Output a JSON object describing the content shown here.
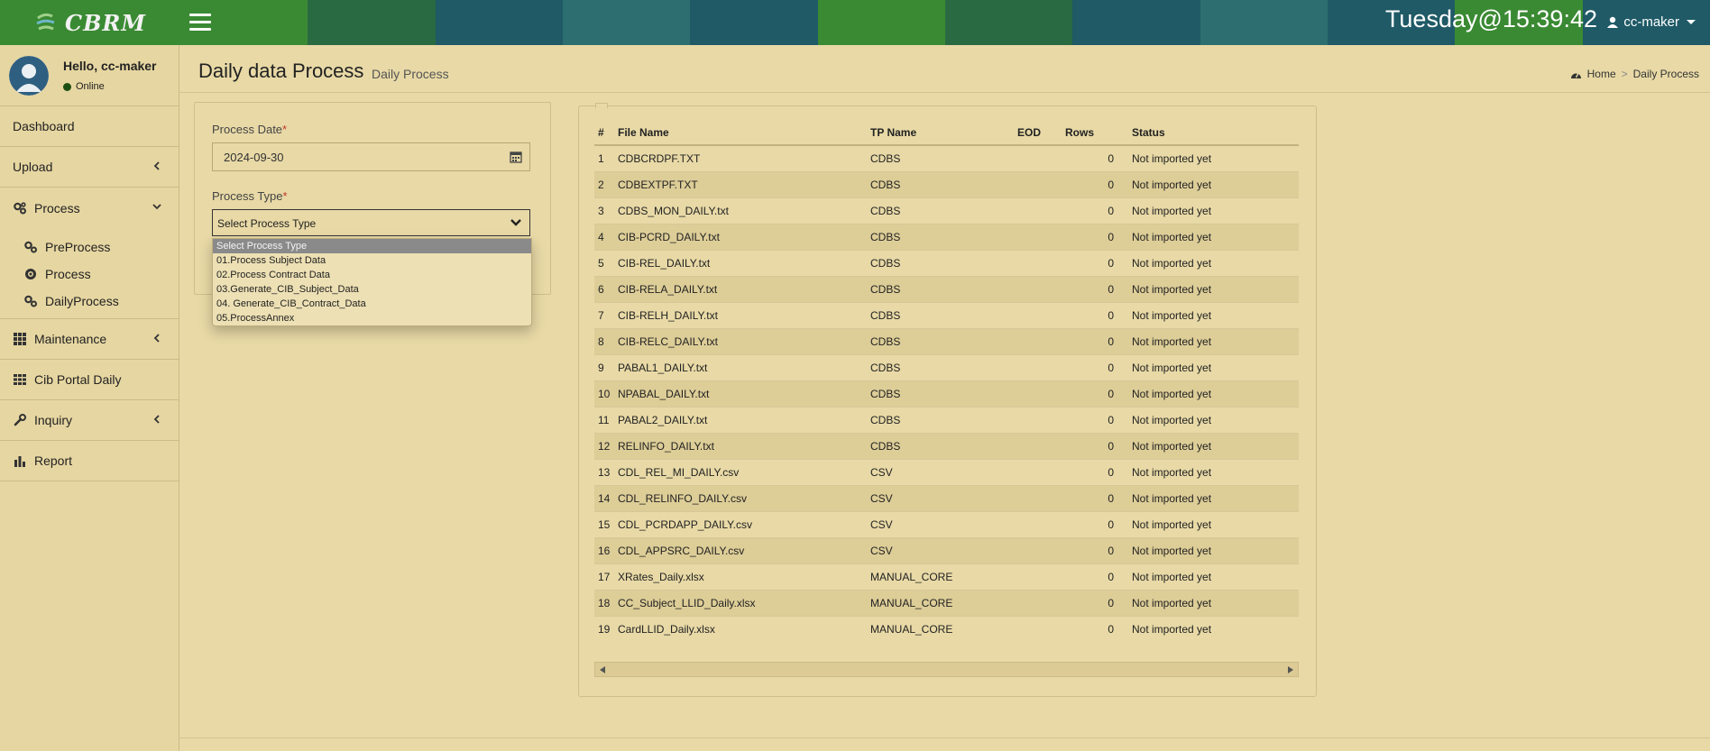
{
  "header": {
    "logo_text": "CBRM",
    "clock": "Tuesday@15:39:42",
    "user": "cc-maker",
    "bands": [
      "#3a8a33",
      "#2a6a42",
      "#1f5a66",
      "#2d6f70",
      "#1f5a66",
      "#3a8a33",
      "#2a6a42",
      "#1f5a66",
      "#2d6f70",
      "#1f5a66",
      "#3a8a33",
      "#1f5a66"
    ]
  },
  "sidebar": {
    "greeting": "Hello, cc-maker",
    "status": "Online",
    "items": [
      {
        "label": "Dashboard",
        "icon": ""
      },
      {
        "label": "Upload",
        "icon": ""
      },
      {
        "label": "Process",
        "icon": "gears-icon"
      },
      {
        "label": "Maintenance",
        "icon": "grid-icon"
      },
      {
        "label": "Cib Portal Daily",
        "icon": "grid-small-icon"
      },
      {
        "label": "Inquiry",
        "icon": "wrench-icon"
      },
      {
        "label": "Report",
        "icon": "bar-chart-icon"
      }
    ],
    "process_sub": [
      {
        "label": "PreProcess",
        "icon": "gears-icon"
      },
      {
        "label": "Process",
        "icon": "gear-icon"
      },
      {
        "label": "DailyProcess",
        "icon": "gears-icon"
      }
    ]
  },
  "page": {
    "title": "Daily data Process",
    "subtitle": "Daily Process",
    "breadcrumb_home": "Home",
    "breadcrumb_sep": ">",
    "breadcrumb_current": "Daily Process"
  },
  "form": {
    "date_label": "Process Date",
    "date_value": "2024-09-30",
    "type_label": "Process Type",
    "required_mark": "*",
    "select_value": "Select Process Type",
    "options": [
      "Select Process Type",
      "01.Process Subject Data",
      "02.Process Contract Data",
      "03.Generate_CIB_Subject_Data",
      "04. Generate_CIB_Contract_Data",
      "05.ProcessAnnex"
    ]
  },
  "table": {
    "columns": [
      "#",
      "File Name",
      "TP Name",
      "EOD",
      "Rows",
      "Status"
    ],
    "rows": [
      [
        "1",
        "CDBCRDPF.TXT",
        "CDBS",
        "",
        "0",
        "Not imported yet"
      ],
      [
        "2",
        "CDBEXTPF.TXT",
        "CDBS",
        "",
        "0",
        "Not imported yet"
      ],
      [
        "3",
        "CDBS_MON_DAILY.txt",
        "CDBS",
        "",
        "0",
        "Not imported yet"
      ],
      [
        "4",
        "CIB-PCRD_DAILY.txt",
        "CDBS",
        "",
        "0",
        "Not imported yet"
      ],
      [
        "5",
        "CIB-REL_DAILY.txt",
        "CDBS",
        "",
        "0",
        "Not imported yet"
      ],
      [
        "6",
        "CIB-RELA_DAILY.txt",
        "CDBS",
        "",
        "0",
        "Not imported yet"
      ],
      [
        "7",
        "CIB-RELH_DAILY.txt",
        "CDBS",
        "",
        "0",
        "Not imported yet"
      ],
      [
        "8",
        "CIB-RELC_DAILY.txt",
        "CDBS",
        "",
        "0",
        "Not imported yet"
      ],
      [
        "9",
        "PABAL1_DAILY.txt",
        "CDBS",
        "",
        "0",
        "Not imported yet"
      ],
      [
        "10",
        "NPABAL_DAILY.txt",
        "CDBS",
        "",
        "0",
        "Not imported yet"
      ],
      [
        "11",
        "PABAL2_DAILY.txt",
        "CDBS",
        "",
        "0",
        "Not imported yet"
      ],
      [
        "12",
        "RELINFO_DAILY.txt",
        "CDBS",
        "",
        "0",
        "Not imported yet"
      ],
      [
        "13",
        "CDL_REL_MI_DAILY.csv",
        "CSV",
        "",
        "0",
        "Not imported yet"
      ],
      [
        "14",
        "CDL_RELINFO_DAILY.csv",
        "CSV",
        "",
        "0",
        "Not imported yet"
      ],
      [
        "15",
        "CDL_PCRDAPP_DAILY.csv",
        "CSV",
        "",
        "0",
        "Not imported yet"
      ],
      [
        "16",
        "CDL_APPSRC_DAILY.csv",
        "CSV",
        "",
        "0",
        "Not imported yet"
      ],
      [
        "17",
        "XRates_Daily.xlsx",
        "MANUAL_CORE",
        "",
        "0",
        "Not imported yet"
      ],
      [
        "18",
        "CC_Subject_LLID_Daily.xlsx",
        "MANUAL_CORE",
        "",
        "0",
        "Not imported yet"
      ],
      [
        "19",
        "CardLLID_Daily.xlsx",
        "MANUAL_CORE",
        "",
        "0",
        "Not imported yet"
      ]
    ]
  }
}
